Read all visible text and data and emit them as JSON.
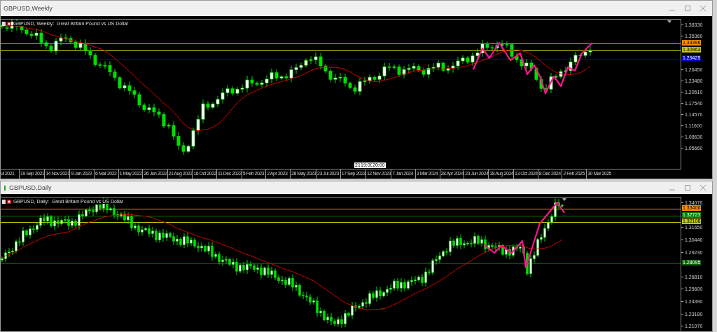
{
  "windows": [
    {
      "title": "GBPUSD,Weekly",
      "header": "GBPUSD, Weekly:  Great Britain Pound vs US Dollar",
      "price_ticks": [
        "1.38330",
        "1.35360",
        "1.26450",
        "1.23480",
        "1.20510",
        "1.17540",
        "1.14570",
        "1.11600",
        "1.08630",
        "1.05660"
      ],
      "levels": [
        {
          "label": "1.33396",
          "color": "#ff8c00"
        },
        {
          "label": "1.30963",
          "color": "#c8c800"
        },
        {
          "label": "1.29425",
          "color": "#0000c8"
        }
      ],
      "date_labels": [
        "ul 2021",
        "19 Sep 2021",
        "14 Nov 2021",
        "9 Jan 2022",
        "6 Mar 2022",
        "1 May 2022",
        "26 Jun 2022",
        "21 Aug 2022",
        "16 Oct 2022",
        "11 Dec 2022",
        "5 Feb 2023",
        "2 Apr 2023",
        "28 May 2023",
        "23 Jul 2023",
        "17 Sep 2023",
        "12 Nov 2023",
        "7 Jan 2024",
        "3 Mar 2024",
        "28 Apr 2024",
        "23 Jun 2024",
        "18 Aug 2024",
        "13 Oct 2024",
        "8 Dec 2024",
        "2 Feb 2025",
        "30 Mar 2025"
      ],
      "crosshair_labels": [
        "21",
        "19:00",
        "20:00"
      ]
    },
    {
      "title": "GBPUSD,Daily",
      "header": "GBPUSD, Daily:  Great Britain Pound vs US Dollar",
      "price_ticks": [
        "1.34070",
        "1.31650",
        "1.30440",
        "1.29230",
        "1.26810",
        "1.25600",
        "1.24390",
        "1.23180",
        "1.21970"
      ],
      "levels": [
        {
          "label": "1.33406",
          "color": "#ff8c00"
        },
        {
          "label": "1.32723",
          "color": "#008000"
        },
        {
          "label": "1.32108",
          "color": "#c8c800"
        },
        {
          "label": "1.28095",
          "color": "#006400"
        }
      ]
    }
  ]
}
